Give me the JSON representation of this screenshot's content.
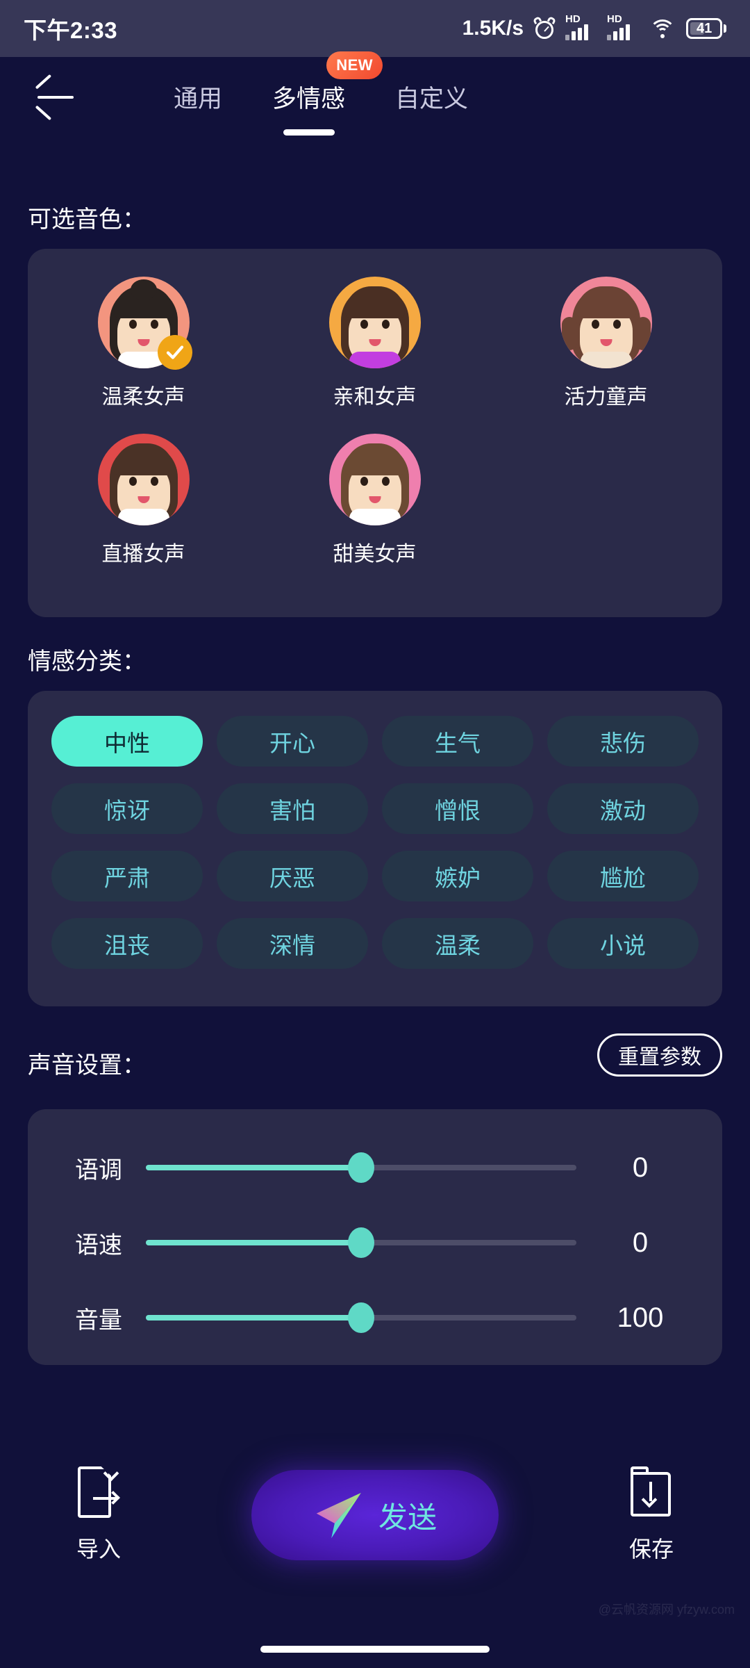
{
  "status_bar": {
    "time": "下午2:33",
    "network_speed": "1.5K/s",
    "hd_label_1": "HD",
    "hd_label_2": "HD",
    "battery_level": "41",
    "icons": [
      "alarm-clock-icon",
      "signal-hd-icon",
      "signal-hd-icon",
      "wifi-icon",
      "battery-icon"
    ]
  },
  "topnav": {
    "back_icon": "back-arrow-icon",
    "tabs": [
      {
        "label": "通用",
        "active": false,
        "badge": ""
      },
      {
        "label": "多情感",
        "active": true,
        "badge": "NEW"
      },
      {
        "label": "自定义",
        "active": false,
        "badge": ""
      }
    ]
  },
  "voices": {
    "title": "可选音色：",
    "items": [
      {
        "label": "温柔女声",
        "selected": true,
        "ring": "#f3957f",
        "hair": "#2a2320",
        "shirt": "#ffffff",
        "style": "bun"
      },
      {
        "label": "亲和女声",
        "selected": false,
        "ring": "#f5a942",
        "hair": "#4a2f23",
        "shirt": "#c23ee0",
        "style": "long"
      },
      {
        "label": "活力童声",
        "selected": false,
        "ring": "#f08698",
        "hair": "#6b4334",
        "shirt": "#f2e3d0",
        "style": "braids"
      },
      {
        "label": "直播女声",
        "selected": false,
        "ring": "#e04a4a",
        "hair": "#4a3226",
        "shirt": "#ffffff",
        "style": "long"
      },
      {
        "label": "甜美女声",
        "selected": false,
        "ring": "#ef7fae",
        "hair": "#6b4a33",
        "shirt": "#ffffff",
        "style": "long"
      }
    ],
    "check_icon": "check-icon"
  },
  "emotions": {
    "title": "情感分类：",
    "items": [
      {
        "label": "中性",
        "selected": true
      },
      {
        "label": "开心",
        "selected": false
      },
      {
        "label": "生气",
        "selected": false
      },
      {
        "label": "悲伤",
        "selected": false
      },
      {
        "label": "惊讶",
        "selected": false
      },
      {
        "label": "害怕",
        "selected": false
      },
      {
        "label": "憎恨",
        "selected": false
      },
      {
        "label": "激动",
        "selected": false
      },
      {
        "label": "严肃",
        "selected": false
      },
      {
        "label": "厌恶",
        "selected": false
      },
      {
        "label": "嫉妒",
        "selected": false
      },
      {
        "label": "尴尬",
        "selected": false
      },
      {
        "label": "沮丧",
        "selected": false
      },
      {
        "label": "深情",
        "selected": false
      },
      {
        "label": "温柔",
        "selected": false
      },
      {
        "label": "小说",
        "selected": false
      }
    ]
  },
  "voice_settings": {
    "title": "声音设置：",
    "reset_label": "重置参数",
    "sliders": [
      {
        "label": "语调",
        "value": "0",
        "percent": 50
      },
      {
        "label": "语速",
        "value": "0",
        "percent": 50
      },
      {
        "label": "音量",
        "value": "100",
        "percent": 50
      }
    ]
  },
  "bottom_bar": {
    "import_label": "导入",
    "import_icon": "file-export-icon",
    "send_label": "发送",
    "send_icon": "paper-plane-icon",
    "save_label": "保存",
    "save_icon": "folder-download-icon"
  },
  "watermark": "@云帆资源网 yfzyw.com",
  "colors": {
    "page_bg": "#11113a",
    "card_bg": "#2a2a49",
    "accent_cyan": "#56efd4",
    "chip_bg": "#253548",
    "chip_text": "#6fd4e0",
    "send_purple": "#4a1bb8",
    "badge_orange": "#f1492f",
    "check_orange": "#f0a516"
  }
}
